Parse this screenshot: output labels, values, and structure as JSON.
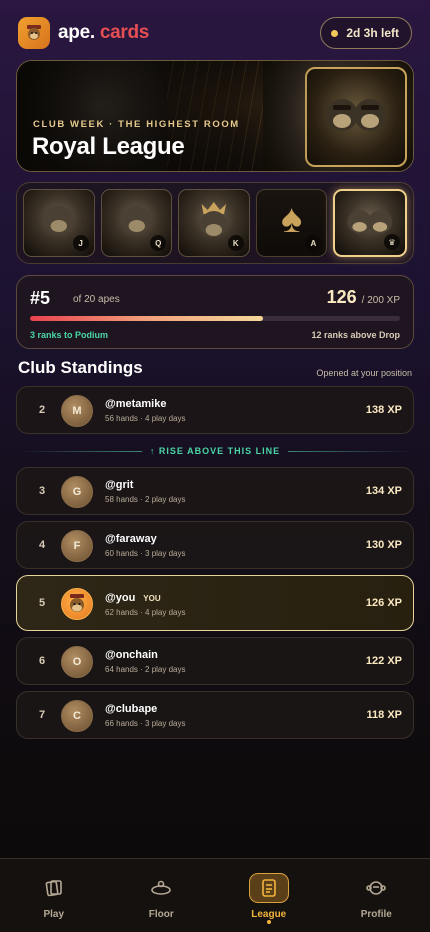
{
  "header": {
    "brand_part1": "ape.",
    "brand_part2": "cards",
    "timer": "2d 3h left"
  },
  "hero": {
    "kicker": "CLUB WEEK · THE HIGHEST ROOM",
    "title": "Royal League"
  },
  "cards": [
    {
      "rank": "J"
    },
    {
      "rank": "Q"
    },
    {
      "rank": "K"
    },
    {
      "rank": "A",
      "suit": "♠"
    },
    {
      "rank": "♛",
      "active": true
    }
  ],
  "rank_panel": {
    "position": "#5",
    "of_label": "of 20 apes",
    "xp_current": "126",
    "xp_max": "/ 200 XP",
    "progress_fraction": 0.63,
    "to_podium": "3 ranks to Podium",
    "above_drop": "12 ranks above Drop"
  },
  "standings": {
    "title": "Club Standings",
    "note": "Opened at your position",
    "divider_label": "↑ RISE ABOVE THIS LINE",
    "you_tag": "YOU",
    "rows": [
      {
        "rank": "2",
        "initial": "M",
        "name": "@metamike",
        "meta": "56 hands · 4 play days",
        "xp": "138 XP"
      },
      {
        "rank": "3",
        "initial": "G",
        "name": "@grit",
        "meta": "58 hands · 2 play days",
        "xp": "134 XP"
      },
      {
        "rank": "4",
        "initial": "F",
        "name": "@faraway",
        "meta": "60 hands · 3 play days",
        "xp": "130 XP"
      },
      {
        "rank": "5",
        "initial": "",
        "name": "@you",
        "meta": "62 hands · 4 play days",
        "xp": "126 XP"
      },
      {
        "rank": "6",
        "initial": "O",
        "name": "@onchain",
        "meta": "64 hands · 2 play days",
        "xp": "122 XP"
      },
      {
        "rank": "7",
        "initial": "C",
        "name": "@clubape",
        "meta": "66 hands · 3 play days",
        "xp": "118 XP"
      }
    ]
  },
  "nav": {
    "items": [
      {
        "label": "Play",
        "icon": "cards-icon"
      },
      {
        "label": "Floor",
        "icon": "table-icon"
      },
      {
        "label": "League",
        "icon": "league-icon",
        "active": true
      },
      {
        "label": "Profile",
        "icon": "ape-profile-icon"
      }
    ]
  },
  "colors": {
    "accent_gold": "#f2b43c",
    "brand_red": "#e64f52",
    "rise_green": "#4ad6a4"
  }
}
